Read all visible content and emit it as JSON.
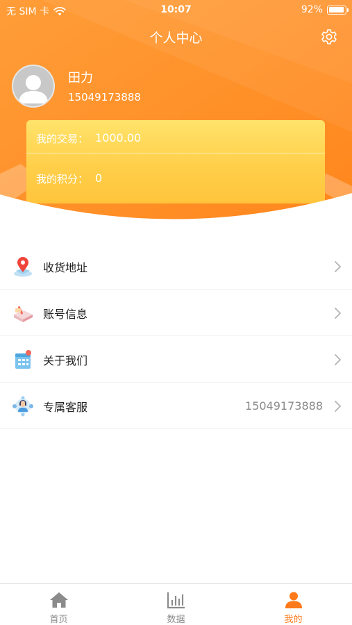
{
  "status_bar": {
    "carrier": "无 SIM 卡",
    "time": "10:07",
    "battery": "92%",
    "battery_level": 0.92
  },
  "header": {
    "title": "个人中心",
    "settings_icon": "gear-icon"
  },
  "profile": {
    "avatar_icon": "user-avatar-icon",
    "name": "田力",
    "phone": "15049173888"
  },
  "stats": {
    "trade_label": "我的交易：",
    "trade_value": "1000.00",
    "points_label": "我的积分：",
    "points_value": "0"
  },
  "menu": [
    {
      "icon": "location-pin-icon",
      "label": "收货地址",
      "value": ""
    },
    {
      "icon": "account-book-icon",
      "label": "账号信息",
      "value": ""
    },
    {
      "icon": "building-icon",
      "label": "关于我们",
      "value": ""
    },
    {
      "icon": "customer-service-icon",
      "label": "专属客服",
      "value": "15049173888"
    }
  ],
  "tabbar": {
    "active_index": 2,
    "items": [
      {
        "icon": "home-icon",
        "label": "首页"
      },
      {
        "icon": "bar-chart-icon",
        "label": "数据"
      },
      {
        "icon": "person-icon",
        "label": "我的"
      }
    ]
  },
  "colors": {
    "accent": "#ff7a1a",
    "header_start": "#ff9a33",
    "header_end": "#ff8a1e",
    "card": "#ffd44e",
    "inactive": "#8b8b8b"
  }
}
